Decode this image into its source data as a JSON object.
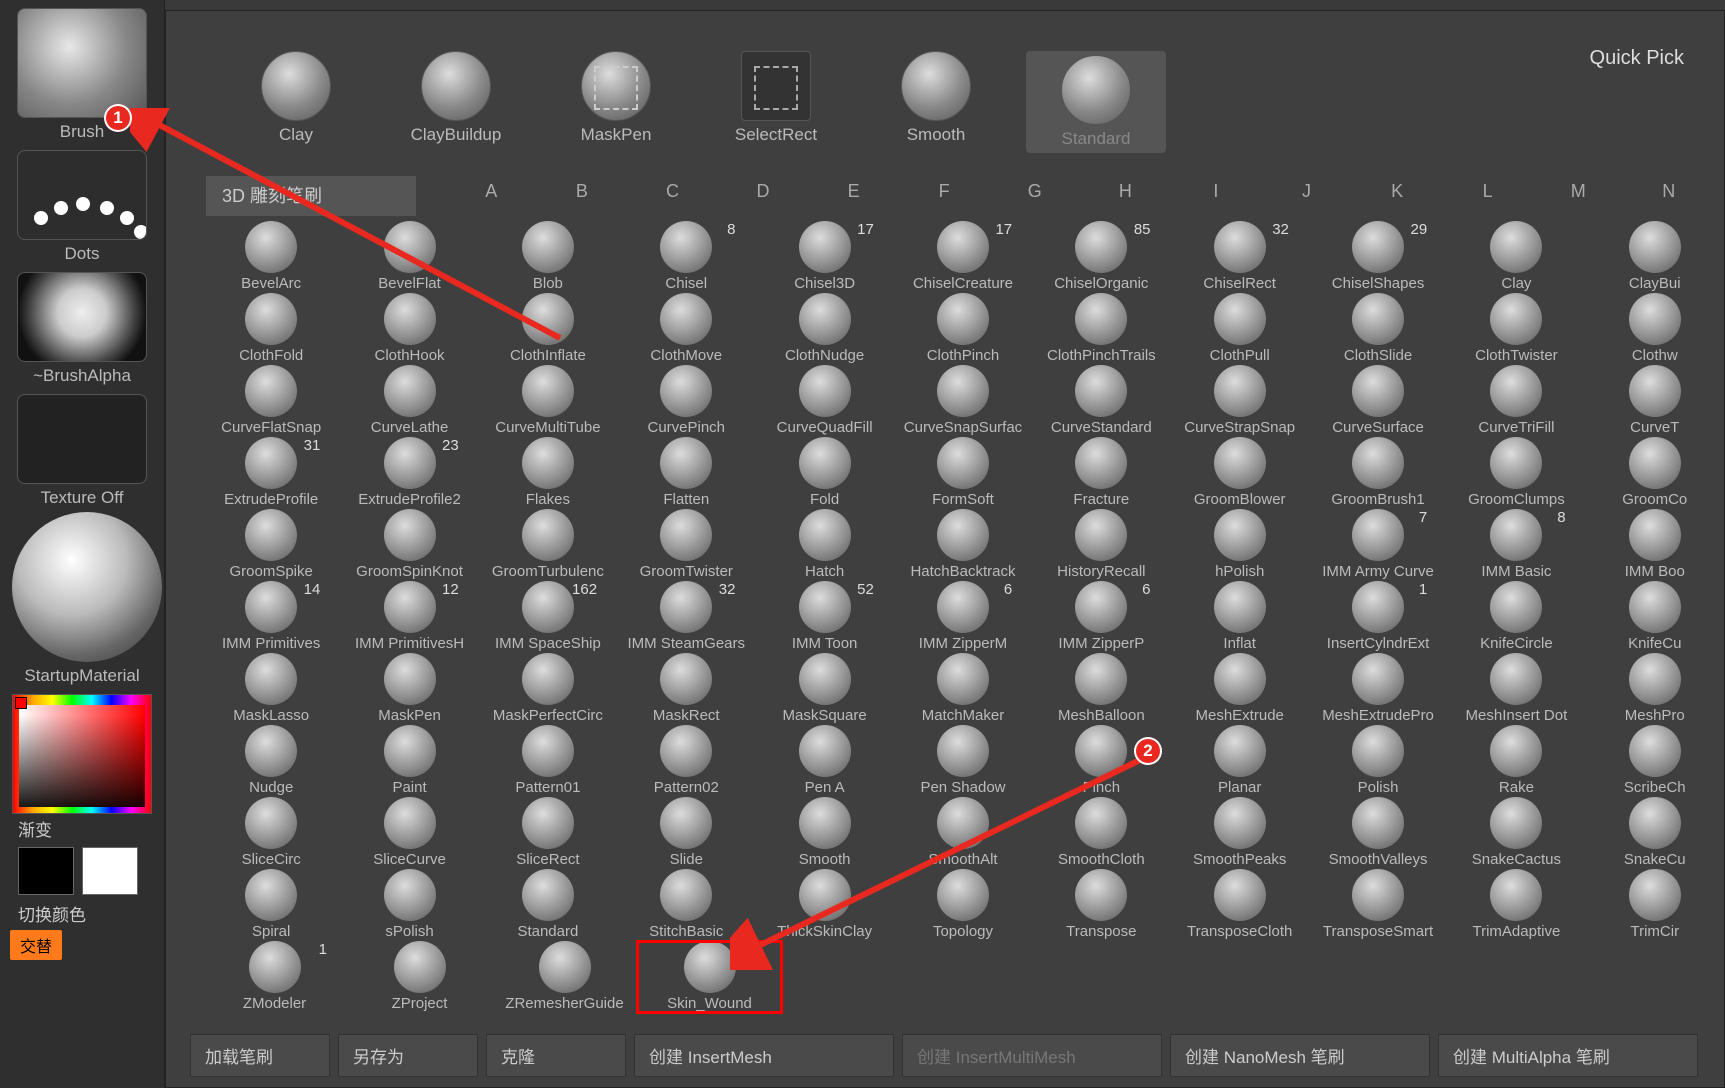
{
  "left": {
    "brush": "Brush",
    "dots": "Dots",
    "alpha": "~BrushAlpha",
    "texture": "Texture Off",
    "material": "StartupMaterial",
    "gradient": "渐变",
    "switch_color": "切换颜色",
    "alternate": "交替"
  },
  "quickpick_label": "Quick Pick",
  "quickpick": [
    {
      "label": "Clay"
    },
    {
      "label": "ClayBuildup"
    },
    {
      "label": "MaskPen"
    },
    {
      "label": "SelectRect"
    },
    {
      "label": "Smooth"
    },
    {
      "label": "Standard"
    }
  ],
  "sculpt_label": "3D 雕刻笔刷",
  "alphabet": [
    "A",
    "B",
    "C",
    "D",
    "E",
    "F",
    "G",
    "H",
    "I",
    "J",
    "K",
    "L",
    "M",
    "N"
  ],
  "rows": [
    [
      {
        "l": "BevelArc"
      },
      {
        "l": "BevelFlat"
      },
      {
        "l": "Blob"
      },
      {
        "l": "Chisel",
        "b": "8"
      },
      {
        "l": "Chisel3D",
        "b": "17"
      },
      {
        "l": "ChiselCreature",
        "b": "17"
      },
      {
        "l": "ChiselOrganic",
        "b": "85"
      },
      {
        "l": "ChiselRect",
        "b": "32"
      },
      {
        "l": "ChiselShapes",
        "b": "29"
      },
      {
        "l": "Clay"
      },
      {
        "l": "ClayBui"
      }
    ],
    [
      {
        "l": "ClothFold"
      },
      {
        "l": "ClothHook"
      },
      {
        "l": "ClothInflate"
      },
      {
        "l": "ClothMove"
      },
      {
        "l": "ClothNudge"
      },
      {
        "l": "ClothPinch"
      },
      {
        "l": "ClothPinchTrails"
      },
      {
        "l": "ClothPull"
      },
      {
        "l": "ClothSlide"
      },
      {
        "l": "ClothTwister"
      },
      {
        "l": "Clothw"
      }
    ],
    [
      {
        "l": "CurveFlatSnap"
      },
      {
        "l": "CurveLathe"
      },
      {
        "l": "CurveMultiTube"
      },
      {
        "l": "CurvePinch"
      },
      {
        "l": "CurveQuadFill"
      },
      {
        "l": "CurveSnapSurfac"
      },
      {
        "l": "CurveStandard"
      },
      {
        "l": "CurveStrapSnap"
      },
      {
        "l": "CurveSurface"
      },
      {
        "l": "CurveTriFill"
      },
      {
        "l": "CurveT"
      }
    ],
    [
      {
        "l": "ExtrudeProfile",
        "b": "31"
      },
      {
        "l": "ExtrudeProfile2",
        "b": "23"
      },
      {
        "l": "Flakes"
      },
      {
        "l": "Flatten"
      },
      {
        "l": "Fold"
      },
      {
        "l": "FormSoft"
      },
      {
        "l": "Fracture"
      },
      {
        "l": "GroomBlower"
      },
      {
        "l": "GroomBrush1"
      },
      {
        "l": "GroomClumps"
      },
      {
        "l": "GroomCo"
      }
    ],
    [
      {
        "l": "GroomSpike"
      },
      {
        "l": "GroomSpinKnot"
      },
      {
        "l": "GroomTurbulenc"
      },
      {
        "l": "GroomTwister"
      },
      {
        "l": "Hatch"
      },
      {
        "l": "HatchBacktrack"
      },
      {
        "l": "HistoryRecall"
      },
      {
        "l": "hPolish"
      },
      {
        "l": "IMM Army Curve",
        "b": "7"
      },
      {
        "l": "IMM Basic",
        "b": "8"
      },
      {
        "l": "IMM Boo"
      }
    ],
    [
      {
        "l": "IMM Primitives",
        "b": "14"
      },
      {
        "l": "IMM PrimitivesH",
        "b": "12"
      },
      {
        "l": "IMM SpaceShip",
        "b": "162"
      },
      {
        "l": "IMM SteamGears",
        "b": "32"
      },
      {
        "l": "IMM Toon",
        "b": "52"
      },
      {
        "l": "IMM ZipperM",
        "b": "6"
      },
      {
        "l": "IMM ZipperP",
        "b": "6"
      },
      {
        "l": "Inflat"
      },
      {
        "l": "InsertCylndrExt",
        "b": "1"
      },
      {
        "l": "KnifeCircle"
      },
      {
        "l": "KnifeCu"
      }
    ],
    [
      {
        "l": "MaskLasso"
      },
      {
        "l": "MaskPen"
      },
      {
        "l": "MaskPerfectCirc"
      },
      {
        "l": "MaskRect"
      },
      {
        "l": "MaskSquare"
      },
      {
        "l": "MatchMaker"
      },
      {
        "l": "MeshBalloon"
      },
      {
        "l": "MeshExtrude"
      },
      {
        "l": "MeshExtrudePro"
      },
      {
        "l": "MeshInsert Dot"
      },
      {
        "l": "MeshPro"
      }
    ],
    [
      {
        "l": "Nudge"
      },
      {
        "l": "Paint"
      },
      {
        "l": "Pattern01"
      },
      {
        "l": "Pattern02"
      },
      {
        "l": "Pen A"
      },
      {
        "l": "Pen Shadow"
      },
      {
        "l": "Pinch"
      },
      {
        "l": "Planar"
      },
      {
        "l": "Polish"
      },
      {
        "l": "Rake"
      },
      {
        "l": "ScribeCh"
      }
    ],
    [
      {
        "l": "SliceCirc"
      },
      {
        "l": "SliceCurve"
      },
      {
        "l": "SliceRect"
      },
      {
        "l": "Slide"
      },
      {
        "l": "Smooth"
      },
      {
        "l": "SmoothAlt"
      },
      {
        "l": "SmoothCloth"
      },
      {
        "l": "SmoothPeaks"
      },
      {
        "l": "SmoothValleys"
      },
      {
        "l": "SnakeCactus"
      },
      {
        "l": "SnakeCu"
      }
    ],
    [
      {
        "l": "Spiral"
      },
      {
        "l": "sPolish"
      },
      {
        "l": "Standard"
      },
      {
        "l": "StitchBasic"
      },
      {
        "l": "ThickSkinClay"
      },
      {
        "l": "Topology"
      },
      {
        "l": "Transpose"
      },
      {
        "l": "TransposeCloth"
      },
      {
        "l": "TransposeSmart"
      },
      {
        "l": "TrimAdaptive"
      },
      {
        "l": "TrimCir"
      }
    ],
    [
      {
        "l": "ZModeler",
        "b": "1"
      },
      {
        "l": "ZProject"
      },
      {
        "l": "ZRemesherGuide"
      },
      {
        "l": "Skin_Wound",
        "hl": true
      }
    ]
  ],
  "bottom": {
    "load": "加载笔刷",
    "saveas": "另存为",
    "clone": "克隆",
    "insertmesh": "创建 InsertMesh",
    "insertmulti": "创建 InsertMultiMesh",
    "nanomesh": "创建 NanoMesh 笔刷",
    "multialpha": "创建 MultiAlpha 笔刷"
  },
  "anno": {
    "one": "1",
    "two": "2"
  }
}
